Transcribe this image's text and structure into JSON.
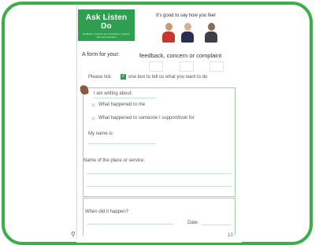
{
  "header": {
    "brand_title": "Ask Listen Do",
    "brand_subtitle": "feedback, concerns and complaints | support, care and education",
    "tagline": "It's good to say how you feel"
  },
  "form_intro": {
    "label": "A form for your:",
    "topics": "feedback, concern or complaint"
  },
  "instruction": {
    "before": "Please tick",
    "tick": "✓",
    "after": "one box to tell us what you want to do"
  },
  "form": {
    "writing_about": "I am writing about:",
    "option_1": "What happened to me",
    "option_2": "What happened to someone I support/look for",
    "my_name": "My name is:",
    "service_name": "Name of the place or service:",
    "when": "When did it happen?",
    "date": "Date:"
  },
  "page_number": "13",
  "colors": {
    "accent": "#2e9e4f",
    "frame": "#3cae4a"
  }
}
